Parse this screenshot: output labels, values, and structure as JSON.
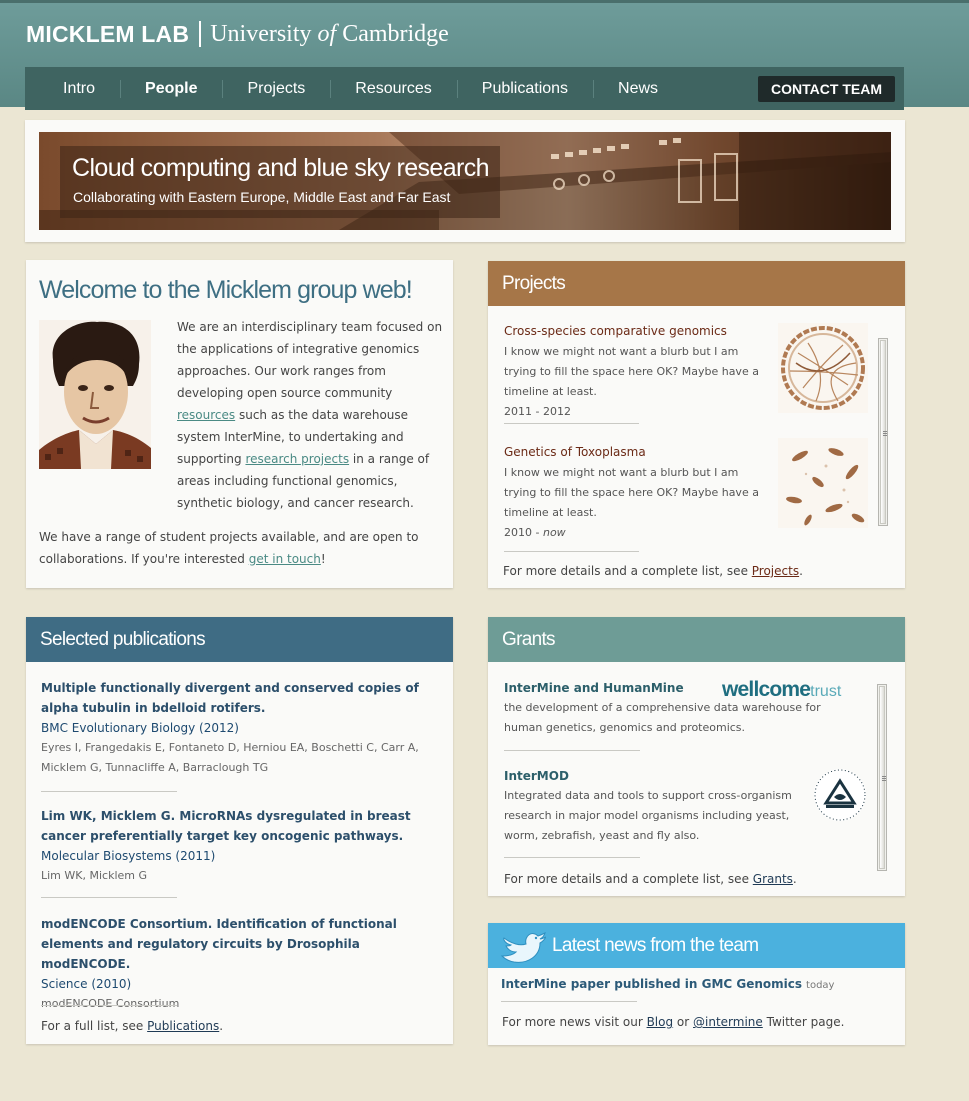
{
  "header": {
    "lab_name": "MICKLEM LAB",
    "university_pre": "University ",
    "university_of": "of",
    "university_post": " Cambridge"
  },
  "nav": {
    "items": [
      {
        "label": "Intro"
      },
      {
        "label": "People",
        "active": true
      },
      {
        "label": "Projects"
      },
      {
        "label": "Resources"
      },
      {
        "label": "Publications"
      },
      {
        "label": "News"
      }
    ],
    "contact_label": "CONTACT TEAM"
  },
  "banner": {
    "title": "Cloud computing and blue sky research",
    "subtitle": "Collaborating with Eastern Europe, Middle East and Far East"
  },
  "welcome": {
    "heading": "Welcome to the Micklem group web!",
    "p1_a": "We are an interdisciplinary team focused on the applications of integrative genomics approaches. Our work ranges from developing open source community ",
    "p1_link1": "resources",
    "p1_b": " such as the data warehouse system InterMine, to undertaking and supporting ",
    "p1_link2": "research projects",
    "p1_c": " in a range of areas including functional genomics, synthetic biology, and cancer research.",
    "p2_a": "We have a range of student projects available, and are open to collaborations. If you're interested ",
    "p2_link": "get in touch",
    "p2_b": "!"
  },
  "projects": {
    "heading": "Projects",
    "items": [
      {
        "title": "Cross-species comparative genomics",
        "desc": "I know we might not want a blurb but I am trying to fill the space here OK? Maybe have a timeline at least.",
        "years": "2011 - 2012",
        "thumb_icon": "circos-plot-thumbnail"
      },
      {
        "title": "Genetics of Toxoplasma",
        "desc": "I know we might not want a blurb but I am trying to fill the space here OK? Maybe have a timeline at least.",
        "year_start": "2010 - ",
        "year_end": "now",
        "thumb_icon": "toxoplasma-micrograph-thumbnail"
      }
    ],
    "footer_text": "For more details and a complete list, see ",
    "footer_link": "Projects",
    "footer_end": "."
  },
  "publications": {
    "heading": "Selected publications",
    "items": [
      {
        "title": "Multiple functionally divergent and conserved copies of alpha tubulin in bdelloid rotifers.",
        "journal": "BMC Evolutionary Biology (2012)",
        "authors": "Eyres I, Frangedakis E, Fontaneto D, Herniou EA, Boschetti C, Carr A, Micklem G, Tunnacliffe A, Barraclough TG"
      },
      {
        "title": "Lim WK, Micklem G. MicroRNAs dysregulated in breast cancer preferentially target key oncogenic pathways.",
        "journal": "Molecular Biosystems (2011)",
        "authors": "Lim WK, Micklem G"
      },
      {
        "title": "modENCODE Consortium. Identification of functional elements and regulatory circuits by Drosophila modENCODE.",
        "journal": "Science (2010)",
        "authors": "modENCODE Consortium"
      }
    ],
    "footer_text": "For a full list, see ",
    "footer_link": "Publications",
    "footer_end": "."
  },
  "grants": {
    "heading": "Grants",
    "items": [
      {
        "title": "InterMine and HumanMine",
        "desc": "the development of a comprehensive data warehouse for human genetics, genomics and proteomics.",
        "logo_word1": "wellcome",
        "logo_word2": "trust"
      },
      {
        "title": "InterMOD",
        "desc": "Integrated data and tools to support cross-organism research in major model organisms including yeast, worm, zebrafish, yeast and fly also.",
        "logo_icon": "nih-seal-icon"
      }
    ],
    "footer_text": "For more details and a complete list, see ",
    "footer_link": "Grants",
    "footer_end": "."
  },
  "news": {
    "heading": "Latest news from the team",
    "headline": "InterMine paper published in GMC Genomics",
    "when": "today",
    "footer_a": "For more news visit our ",
    "link_blog": "Blog",
    "footer_or": " or ",
    "link_twitter": "@intermine",
    "footer_b": " Twitter page."
  },
  "colors": {
    "header_teal": "#5a8784",
    "nav_dark": "#3f6461",
    "projects_brown": "#a67648",
    "publications_blue": "#3f6c84",
    "grants_teal": "#6e9c96",
    "news_blue": "#4bb1de",
    "page_bg": "#ebe6d3"
  }
}
